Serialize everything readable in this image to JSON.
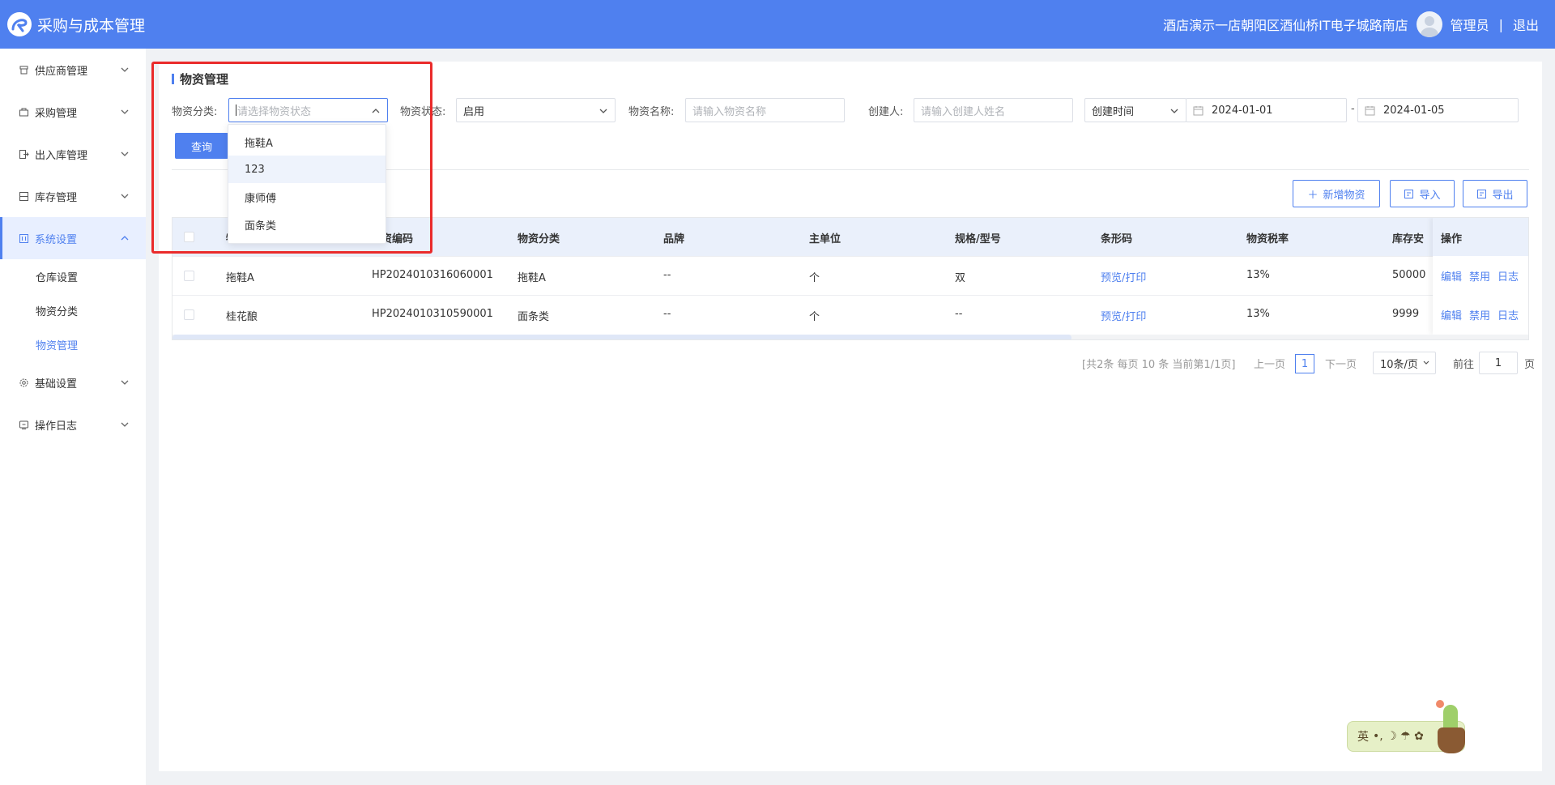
{
  "header": {
    "app_title": "采购与成本管理",
    "store_name": "酒店演示一店朝阳区酒仙桥IT电子城路南店",
    "user_name": "管理员",
    "separator": "|",
    "logout": "退出",
    "bg_color": "#4f80ef"
  },
  "sidebar": {
    "items": [
      {
        "label": "供应商管理",
        "icon": "supplier-icon"
      },
      {
        "label": "采购管理",
        "icon": "purchase-icon"
      },
      {
        "label": "出入库管理",
        "icon": "inout-icon"
      },
      {
        "label": "库存管理",
        "icon": "inventory-icon"
      },
      {
        "label": "系统设置",
        "icon": "settings-panel-icon",
        "active": true
      },
      {
        "label": "基础设置",
        "icon": "gear-icon"
      },
      {
        "label": "操作日志",
        "icon": "log-icon"
      }
    ],
    "sub_items": [
      {
        "label": "仓库设置"
      },
      {
        "label": "物资分类"
      },
      {
        "label": "物资管理",
        "active": true
      }
    ]
  },
  "page": {
    "title": "物资管理"
  },
  "filters": {
    "category_label": "物资分类:",
    "category_placeholder": "请选择物资状态",
    "status_label": "物资状态:",
    "status_value": "启用",
    "name_label": "物资名称:",
    "name_placeholder": "请输入物资名称",
    "creator_label": "创建人:",
    "creator_placeholder": "请输入创建人姓名",
    "time_type": "创建时间",
    "date_from": "2024-01-01",
    "date_separator": "-",
    "date_to": "2024-01-05",
    "query_button": "查询"
  },
  "dropdown": {
    "options": [
      "拖鞋A",
      "123",
      "康师傅",
      "面条类"
    ],
    "hovered_index": 1
  },
  "toolbar": {
    "add_label": "新增物资",
    "import_label": "导入",
    "export_label": "导出"
  },
  "table": {
    "columns": [
      "物资名称",
      "物资编码",
      "物资分类",
      "品牌",
      "主单位",
      "规格/型号",
      "条形码",
      "物资税率",
      "库存安全值",
      "操作"
    ],
    "visible_header_fragments": {
      "name": "物",
      "code": "资编码",
      "stock": "库存安"
    },
    "rows": [
      {
        "name": "拖鞋A",
        "code": "HP2024010316060001",
        "category": "拖鞋A",
        "brand": "--",
        "unit": "个",
        "spec": "双",
        "barcode": "预览/打印",
        "tax": "13%",
        "stock": "50000"
      },
      {
        "name": "桂花酿",
        "code": "HP2024010310590001",
        "category": "面条类",
        "brand": "--",
        "unit": "个",
        "spec": "--",
        "barcode": "预览/打印",
        "tax": "13%",
        "stock": "9999"
      }
    ],
    "actions": [
      "编辑",
      "禁用",
      "日志"
    ]
  },
  "pagination": {
    "summary": "[共2条 每页 10 条 当前第1/1页]",
    "prev": "上一页",
    "current": "1",
    "next": "下一页",
    "page_size": "10条/页",
    "goto_prefix": "前往",
    "goto_value": "1",
    "goto_suffix": "页"
  },
  "ime": {
    "lang": "英",
    "symbols": "•, ☽ ☂ ✿"
  }
}
